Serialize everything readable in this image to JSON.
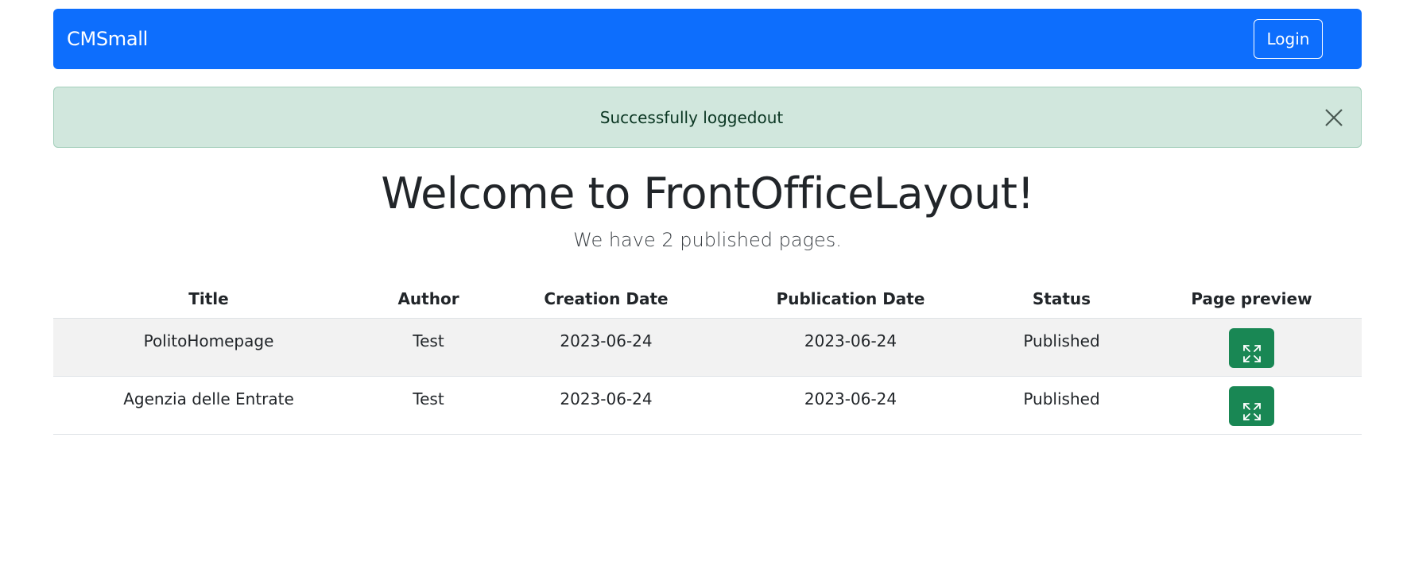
{
  "navbar": {
    "brand": "CMSmall",
    "login_label": "Login",
    "color": "#0d6efd"
  },
  "alert": {
    "message": "Successfully loggedout",
    "close_icon": "close-icon",
    "color": "#d1e7dd"
  },
  "main": {
    "title": "Welcome to FrontOfficeLayout!",
    "subtitle": "We have 2 published pages."
  },
  "table": {
    "headers": [
      "Title",
      "Author",
      "Creation Date",
      "Publication Date",
      "Status",
      "Page preview"
    ],
    "rows": [
      {
        "title": "PolitoHomepage",
        "author": "Test",
        "creation_date": "2023-06-24",
        "publication_date": "2023-06-24",
        "status": "Published",
        "preview_icon": "arrows-fullscreen-icon"
      },
      {
        "title": "Agenzia delle Entrate",
        "author": "Test",
        "creation_date": "2023-06-24",
        "publication_date": "2023-06-24",
        "status": "Published",
        "preview_icon": "arrows-fullscreen-icon"
      }
    ],
    "preview_button_color": "#198754"
  }
}
